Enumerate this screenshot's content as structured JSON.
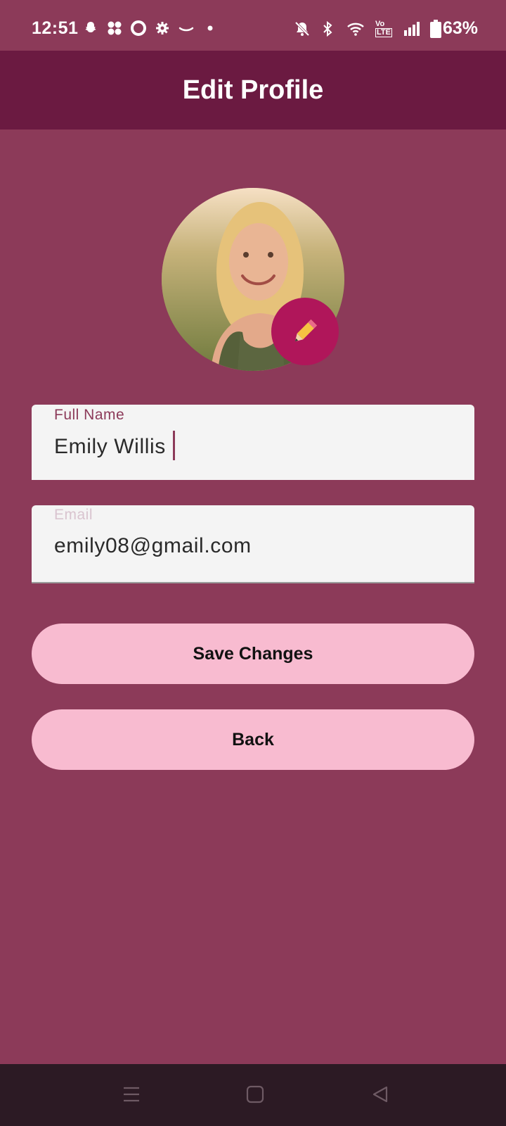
{
  "status_bar": {
    "time": "12:51",
    "battery_percent": "63%",
    "left_icons": [
      "snapchat-icon",
      "fan-icon",
      "ring-icon",
      "gear-icon",
      "amazon-icon",
      "dot-icon"
    ],
    "right_icons": [
      "bell-muted-icon",
      "bluetooth-icon",
      "wifi-icon",
      "volte-icon",
      "signal-icon",
      "battery-icon"
    ],
    "volte_label_top": "Vo",
    "volte_label_bottom": "LTE"
  },
  "app_bar": {
    "title": "Edit Profile"
  },
  "avatar": {
    "edit_icon": "pencil-icon"
  },
  "form": {
    "full_name": {
      "label": "Full Name",
      "value": "Emily Willis"
    },
    "email": {
      "label": "Email",
      "value": "emily08@gmail.com"
    }
  },
  "buttons": {
    "save_label": "Save Changes",
    "back_label": "Back"
  },
  "nav_bar": {
    "icons": [
      "menu-icon",
      "home-square-icon",
      "back-triangle-icon"
    ]
  },
  "colors": {
    "background": "#8c3a59",
    "app_bar": "#6b1a41",
    "accent": "#b0165a",
    "button": "#f8bbd0",
    "field": "#f4f4f4",
    "nav_bar": "#2c1a24"
  }
}
